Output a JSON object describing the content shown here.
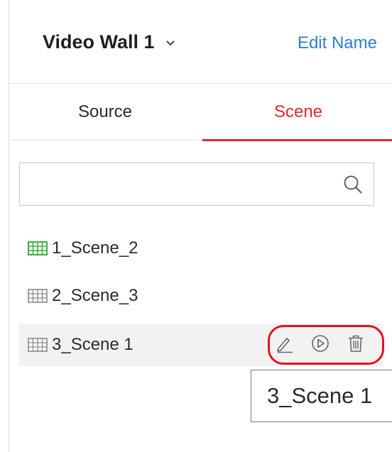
{
  "header": {
    "wall_name": "Video Wall 1",
    "edit_name_label": "Edit Name"
  },
  "tabs": [
    {
      "label": "Source",
      "active": false
    },
    {
      "label": "Scene",
      "active": true
    }
  ],
  "search": {
    "value": "",
    "placeholder": ""
  },
  "scenes": [
    {
      "label": "1_Scene_2",
      "icon": "grid-icon",
      "icon_color": "#3cb043",
      "active": false
    },
    {
      "label": "2_Scene_3",
      "icon": "grid-icon",
      "icon_color": "#8a8a8a",
      "active": false
    },
    {
      "label": "3_Scene 1",
      "icon": "grid-icon",
      "icon_color": "#8a8a8a",
      "active": true
    }
  ],
  "row_actions": [
    "edit-icon",
    "play-icon",
    "delete-icon"
  ],
  "tooltip": {
    "text": "3_Scene 1"
  },
  "colors": {
    "accent": "#e0292f",
    "link": "#2d7fd1",
    "highlight_ring": "#e8111b",
    "active_scene_icon": "#3cb043"
  }
}
